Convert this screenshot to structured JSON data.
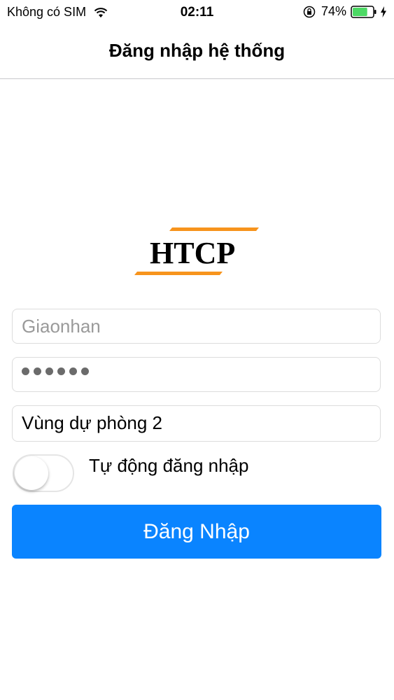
{
  "status_bar": {
    "carrier": "Không có SIM",
    "time": "02:11",
    "battery": "74%",
    "battery_level": 0.74,
    "icons": [
      "wifi-icon",
      "orientation-lock-icon",
      "battery-icon",
      "charging-bolt-icon"
    ]
  },
  "nav": {
    "title": "Đăng nhập hệ thống"
  },
  "logo": {
    "text": "HTCP",
    "accent_color": "#f7941d"
  },
  "form": {
    "username_placeholder": "Giaonhan",
    "password_masked_length": 6,
    "region_value": "Vùng dự phòng 2",
    "auto_login_label": "Tự động đăng nhập",
    "auto_login_on": false,
    "login_button": "Đăng Nhập"
  },
  "colors": {
    "primary": "#0a84ff",
    "battery_green": "#4cd964"
  }
}
